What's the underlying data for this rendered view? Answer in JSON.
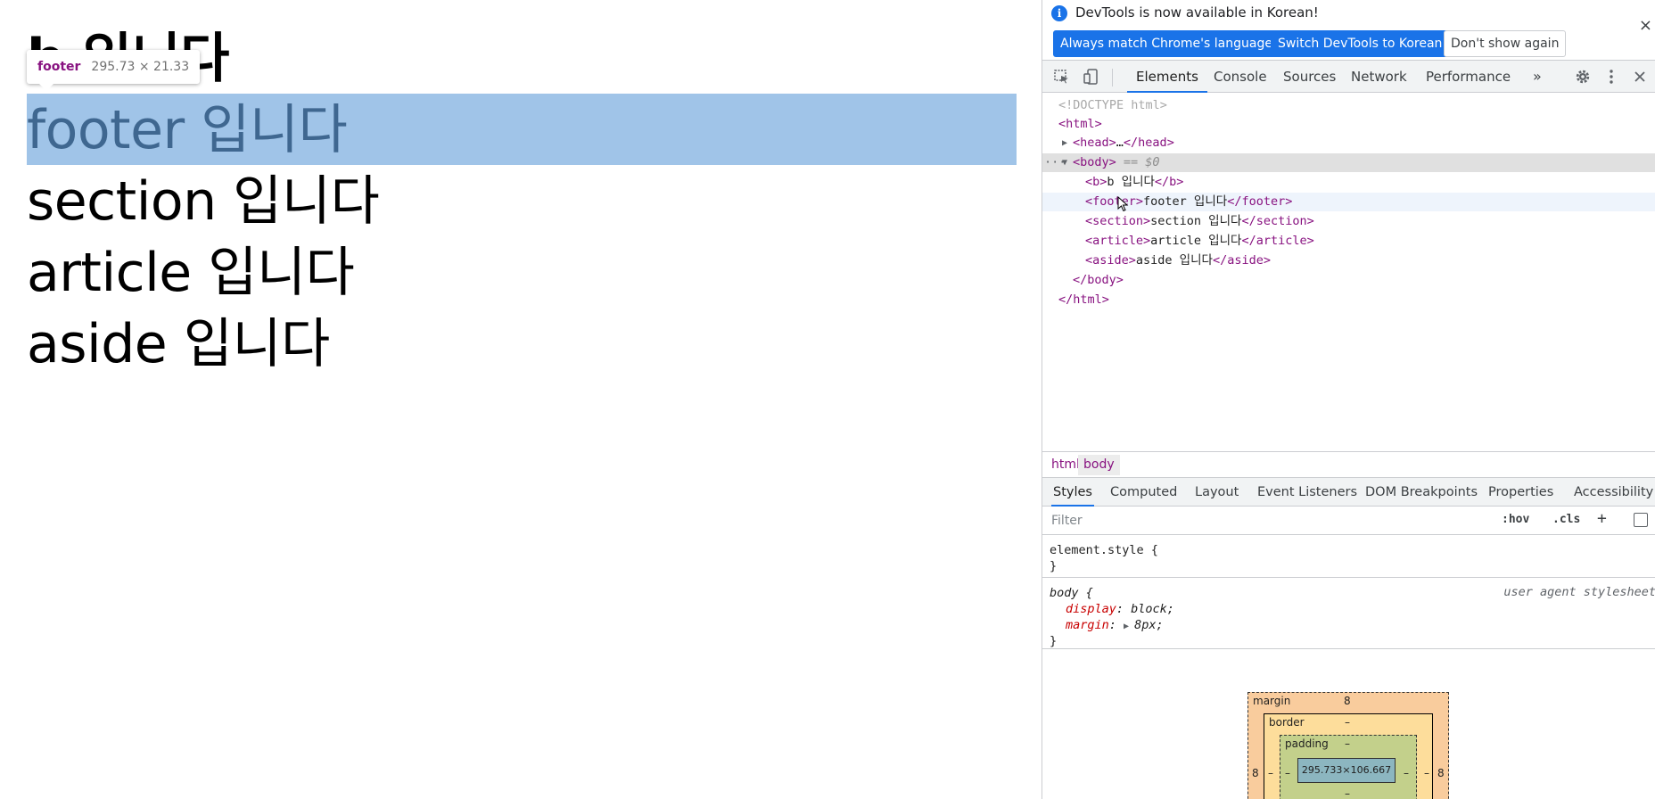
{
  "page": {
    "lines": {
      "b": "b 입니다",
      "footer": "footer 입니다",
      "section": "section 입니다",
      "article": "article 입니다",
      "aside": "aside 입니다"
    },
    "tooltip": {
      "tag": "footer",
      "dims": "295.73 × 21.33"
    }
  },
  "devtools": {
    "infobar": {
      "message": "DevTools is now available in Korean!",
      "btn_match": "Always match Chrome's language",
      "btn_switch": "Switch DevTools to Korean",
      "btn_dont": "Don't show again",
      "close": "×"
    },
    "tabs": {
      "elements": "Elements",
      "console": "Console",
      "sources": "Sources",
      "network": "Network",
      "performance": "Performance",
      "more": "»"
    },
    "dom": {
      "doctype": "<!DOCTYPE html>",
      "html_open": "<html>",
      "head_open": "<head>",
      "head_ellipsis": "…",
      "head_close": "</head>",
      "body_open": "<body>",
      "body_eq": "== $0",
      "dots": "···",
      "b_open": "<b>",
      "b_text": "b 입니다",
      "b_close": "</b>",
      "footer_open": "<footer>",
      "footer_text": "footer 입니다",
      "footer_close": "</footer>",
      "section_open": "<section>",
      "section_text": "section 입니다",
      "section_close": "</section>",
      "article_open": "<article>",
      "article_text": "article 입니다",
      "article_close": "</article>",
      "aside_open": "<aside>",
      "aside_text": "aside 입니다",
      "aside_close": "</aside>",
      "body_close": "</body>",
      "html_close": "</html>"
    },
    "breadcrumbs": {
      "html": "html",
      "body": "body"
    },
    "style_tabs": {
      "styles": "Styles",
      "computed": "Computed",
      "layout": "Layout",
      "events": "Event Listeners",
      "dom_bp": "DOM Breakpoints",
      "properties": "Properties",
      "accessibility": "Accessibility"
    },
    "filter": {
      "placeholder": "Filter",
      "hov": ":hov",
      "cls": ".cls",
      "plus": "+"
    },
    "rules": {
      "element_style": "element.style {",
      "close_brace": "}",
      "body_selector": "body {",
      "ua": "user agent stylesheet",
      "display_name": "display",
      "display_value": "block;",
      "margin_name": "margin",
      "margin_value": "8px;"
    },
    "boxmodel": {
      "margin_label": "margin",
      "margin_top": "8",
      "margin_left": "8",
      "margin_right": "8",
      "border_label": "border",
      "border_val": "–",
      "padding_label": "padding",
      "padding_val": "–",
      "content": "295.733×106.667"
    }
  },
  "colors": {
    "highlight": "#a0c4e8",
    "accent": "#1a73e8",
    "tag": "#881280",
    "prop_name": "#c80000"
  }
}
